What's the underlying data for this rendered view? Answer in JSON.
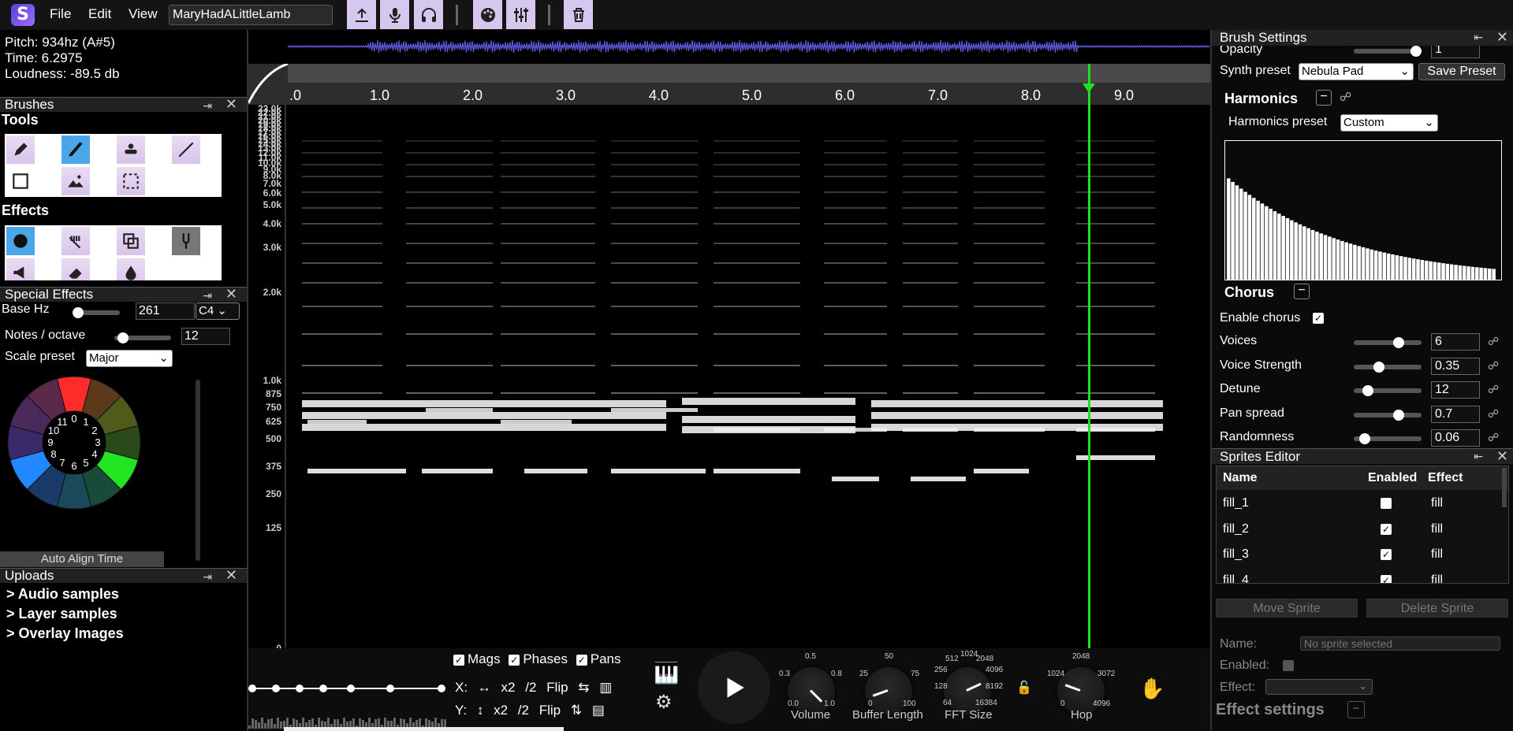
{
  "app": {
    "logo_letter": "S",
    "title_value": "MaryHadALittleLamb"
  },
  "menu": {
    "file": "File",
    "edit": "Edit",
    "view": "View"
  },
  "toolbar_icons": [
    "upload-icon",
    "mic-icon",
    "headphones-icon",
    "palette-icon",
    "sliders-icon",
    "trash-icon"
  ],
  "info": {
    "pitch": "Pitch: 934hz (A#5)",
    "time": "Time: 6.2975",
    "loudness": "Loudness: -89.5 db"
  },
  "brushes_panel": {
    "title": "Brushes",
    "tools_label": "Tools",
    "effects_label": "Effects"
  },
  "special_effects": {
    "title": "Special Effects",
    "base_hz_label": "Base Hz",
    "base_hz_value": "261",
    "base_note": "C4",
    "notes_label": "Notes / octave",
    "notes_value": "12",
    "scale_label": "Scale preset",
    "scale_value": "Major",
    "wheel_numbers": [
      "0",
      "1",
      "2",
      "3",
      "4",
      "5",
      "6",
      "7",
      "8",
      "9",
      "10",
      "11"
    ],
    "auto_align": "Auto Align Time"
  },
  "uploads": {
    "title": "Uploads",
    "items": [
      "> Audio samples",
      "> Layer samples",
      "> Overlay Images"
    ]
  },
  "timeline": {
    "ticks": [
      ".0",
      "1.0",
      "2.0",
      "3.0",
      "4.0",
      "5.0",
      "6.0",
      "7.0",
      "8.0",
      "9.0"
    ],
    "playhead_time": 8.6
  },
  "freq_labels": [
    "23.0k",
    "22.0k",
    "21.0k",
    "20.0k",
    "19.0k",
    "18.0k",
    "17.0k",
    "16.0k",
    "15.0k",
    "14.0k",
    "13.0k",
    "12.0k",
    "11.0k",
    "10.0k",
    "9.0k",
    "8.0k",
    "7.0k",
    "6.0k",
    "5.0k",
    "4.0k",
    "3.0k",
    "2.0k",
    "1.0k",
    "875",
    "750",
    "625",
    "500",
    "375",
    "250",
    "125",
    "0"
  ],
  "bottom": {
    "mags": "Mags",
    "phases": "Phases",
    "pans": "Pans",
    "x_label": "X:",
    "y_label": "Y:",
    "x2": "x2",
    "div2": "/2",
    "flip": "Flip",
    "knobs": {
      "volume": {
        "name": "Volume",
        "top": "0.5",
        "left": "0.3",
        "right": "0.8",
        "bl": "0.0",
        "br": "1.0"
      },
      "buffer": {
        "name": "Buffer Length",
        "top": "50",
        "left": "25",
        "right": "75",
        "bl": "0",
        "br": "100"
      },
      "fft": {
        "name": "FFT Size",
        "top": "1024",
        "tl": "512",
        "tr": "2048",
        "l1": "256",
        "r1": "4096",
        "l2": "128",
        "r2": "8192",
        "bl": "64",
        "br": "16384"
      },
      "hop": {
        "name": "Hop",
        "top": "2048",
        "left": "1024",
        "right": "3072",
        "bl": "0",
        "br": "4096"
      }
    }
  },
  "brush_settings": {
    "title": "Brush Settings",
    "opacity_label": "Opacity",
    "opacity_value": "1",
    "synth_label": "Synth preset",
    "synth_value": "Nebula Pad",
    "save_preset": "Save Preset",
    "harmonics_title": "Harmonics",
    "harmonics_preset_label": "Harmonics preset",
    "harmonics_preset_value": "Custom",
    "chorus_title": "Chorus",
    "enable_chorus": "Enable chorus",
    "rows": [
      {
        "label": "Voices",
        "value": "6",
        "fraction": 0.7
      },
      {
        "label": "Voice Strength",
        "value": "0.35",
        "fraction": 0.35
      },
      {
        "label": "Detune",
        "value": "12",
        "fraction": 0.15
      },
      {
        "label": "Pan spread",
        "value": "0.7",
        "fraction": 0.7
      },
      {
        "label": "Randomness",
        "value": "0.06",
        "fraction": 0.1
      }
    ]
  },
  "sprites": {
    "title": "Sprites Editor",
    "headers": [
      "Name",
      "Enabled",
      "Effect"
    ],
    "rows": [
      {
        "name": "fill_1",
        "enabled": false,
        "effect": "fill"
      },
      {
        "name": "fill_2",
        "enabled": true,
        "effect": "fill"
      },
      {
        "name": "fill_3",
        "enabled": true,
        "effect": "fill"
      },
      {
        "name": "fill_4",
        "enabled": true,
        "effect": "fill"
      }
    ],
    "move": "Move Sprite",
    "delete": "Delete Sprite",
    "name_label": "Name:",
    "name_placeholder": "No sprite selected",
    "enabled_label": "Enabled:",
    "effect_label": "Effect:",
    "effect_settings": "Effect settings"
  },
  "colors": {
    "accent": "#d6c7ef",
    "playhead": "#22dd22",
    "waveform": "#5a5ad8"
  }
}
